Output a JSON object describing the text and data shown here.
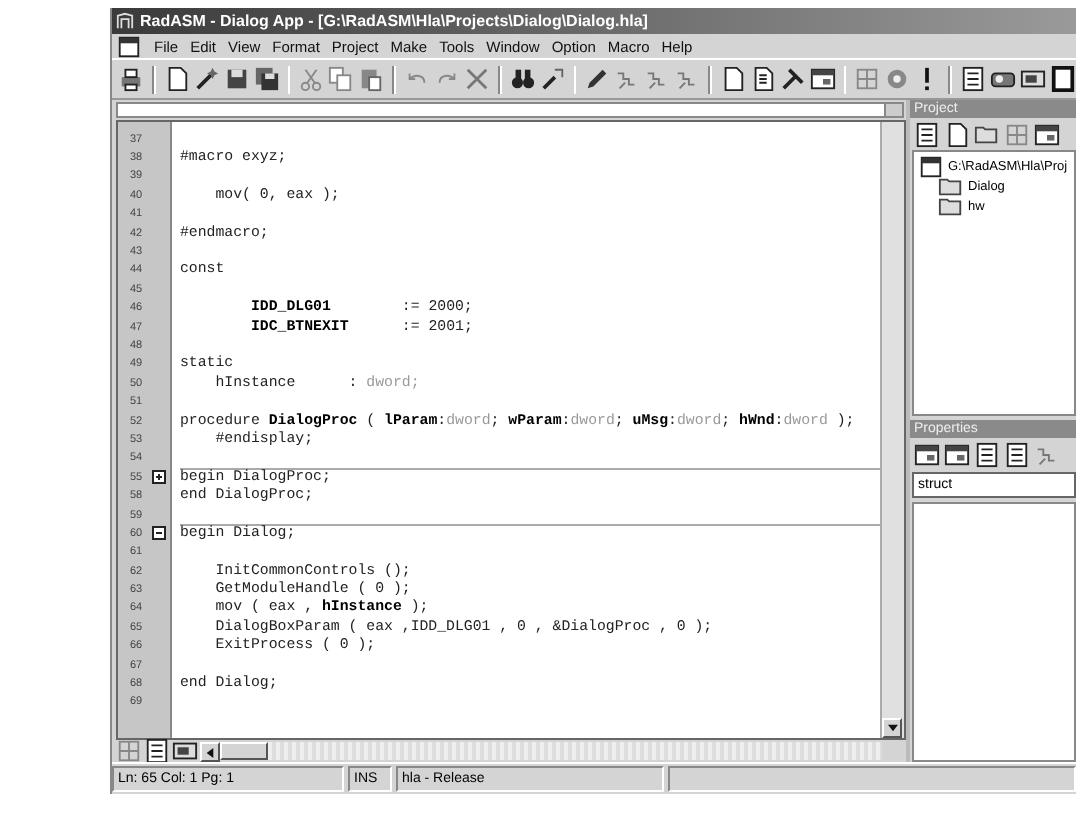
{
  "window": {
    "title": "RadASM - Dialog App - [G:\\RadASM\\Hla\\Projects\\Dialog\\Dialog.hla]"
  },
  "menu": [
    "File",
    "Edit",
    "View",
    "Format",
    "Project",
    "Make",
    "Tools",
    "Window",
    "Option",
    "Macro",
    "Help"
  ],
  "editor": {
    "lines": [
      {
        "number": "37"
      },
      {
        "number": "38",
        "segments": [
          {
            "kind": "plain",
            "text": "#macro exyz;"
          }
        ]
      },
      {
        "number": "39"
      },
      {
        "number": "40",
        "segments": [
          {
            "kind": "plain",
            "text": "    mov( 0, eax );"
          }
        ]
      },
      {
        "number": "41"
      },
      {
        "number": "42",
        "segments": [
          {
            "kind": "plain",
            "text": "#endmacro;"
          }
        ]
      },
      {
        "number": "43"
      },
      {
        "number": "44",
        "segments": [
          {
            "kind": "plain",
            "text": "const"
          }
        ]
      },
      {
        "number": "45"
      },
      {
        "number": "46",
        "segments": [
          {
            "kind": "bold",
            "text": "        IDD_DLG01"
          },
          {
            "kind": "plain",
            "text": "        := 2000;"
          }
        ]
      },
      {
        "number": "47",
        "segments": [
          {
            "kind": "bold",
            "text": "        IDC_BTNEXIT"
          },
          {
            "kind": "plain",
            "text": "      := 2001;"
          }
        ]
      },
      {
        "number": "48"
      },
      {
        "number": "49",
        "segments": [
          {
            "kind": "plain",
            "text": "static"
          }
        ]
      },
      {
        "number": "50",
        "segments": [
          {
            "kind": "plain",
            "text": "    hInstance      : "
          },
          {
            "kind": "type",
            "text": "dword;"
          }
        ]
      },
      {
        "number": "51"
      },
      {
        "number": "52",
        "segments": [
          {
            "kind": "plain",
            "text": "procedure "
          },
          {
            "kind": "bold",
            "text": "DialogProc"
          },
          {
            "kind": "plain",
            "text": " ( "
          },
          {
            "kind": "bold",
            "text": "lParam"
          },
          {
            "kind": "plain",
            "text": ":"
          },
          {
            "kind": "type",
            "text": "dword"
          },
          {
            "kind": "plain",
            "text": "; "
          },
          {
            "kind": "bold",
            "text": "wParam"
          },
          {
            "kind": "plain",
            "text": ":"
          },
          {
            "kind": "type",
            "text": "dword"
          },
          {
            "kind": "plain",
            "text": "; "
          },
          {
            "kind": "bold",
            "text": "uMsg"
          },
          {
            "kind": "plain",
            "text": ":"
          },
          {
            "kind": "type",
            "text": "dword"
          },
          {
            "kind": "plain",
            "text": "; "
          },
          {
            "kind": "bold",
            "text": "hWnd"
          },
          {
            "kind": "plain",
            "text": ":"
          },
          {
            "kind": "type",
            "text": "dword"
          },
          {
            "kind": "plain",
            "text": " );"
          }
        ]
      },
      {
        "number": "53",
        "segments": [
          {
            "kind": "plain",
            "text": "    #endisplay;"
          }
        ]
      },
      {
        "number": "54"
      },
      {
        "number": "55",
        "collapsed": true,
        "segments": [
          {
            "kind": "plain",
            "text": "begin DialogProc;"
          }
        ]
      },
      {
        "number": "58",
        "segments": [
          {
            "kind": "plain",
            "text": "end DialogProc;"
          }
        ]
      },
      {
        "number": "59"
      },
      {
        "number": "60",
        "collapsed": false,
        "segments": [
          {
            "kind": "plain",
            "text": "begin Dialog;"
          }
        ]
      },
      {
        "number": "61"
      },
      {
        "number": "62",
        "segments": [
          {
            "kind": "plain",
            "text": "    InitCommonControls ();"
          }
        ]
      },
      {
        "number": "63",
        "segments": [
          {
            "kind": "plain",
            "text": "    GetModuleHandle ( 0 );"
          }
        ]
      },
      {
        "number": "64",
        "segments": [
          {
            "kind": "plain",
            "text": "    mov ( eax , "
          },
          {
            "kind": "bold",
            "text": "hInstance"
          },
          {
            "kind": "plain",
            "text": " );"
          }
        ]
      },
      {
        "number": "65",
        "segments": [
          {
            "kind": "plain",
            "text": "    DialogBoxParam ( eax ,IDD_DLG01 , 0 , &DialogProc , 0 );"
          }
        ]
      },
      {
        "number": "66",
        "segments": [
          {
            "kind": "plain",
            "text": "    ExitProcess ( 0 );"
          }
        ]
      },
      {
        "number": "67"
      },
      {
        "number": "68",
        "segments": [
          {
            "kind": "plain",
            "text": "end Dialog;"
          }
        ]
      },
      {
        "number": "69"
      }
    ]
  },
  "project": {
    "title": "Project",
    "tree": {
      "label": "G:\\RadASM\\Hla\\Proj",
      "children": [
        {
          "label": "Dialog"
        },
        {
          "label": "hw"
        }
      ]
    }
  },
  "properties": {
    "title": "Properties",
    "selector": "struct"
  },
  "status_bar": [
    "Ln: 65 Col: 1 Pg: 1",
    "INS",
    "hla - Release"
  ]
}
